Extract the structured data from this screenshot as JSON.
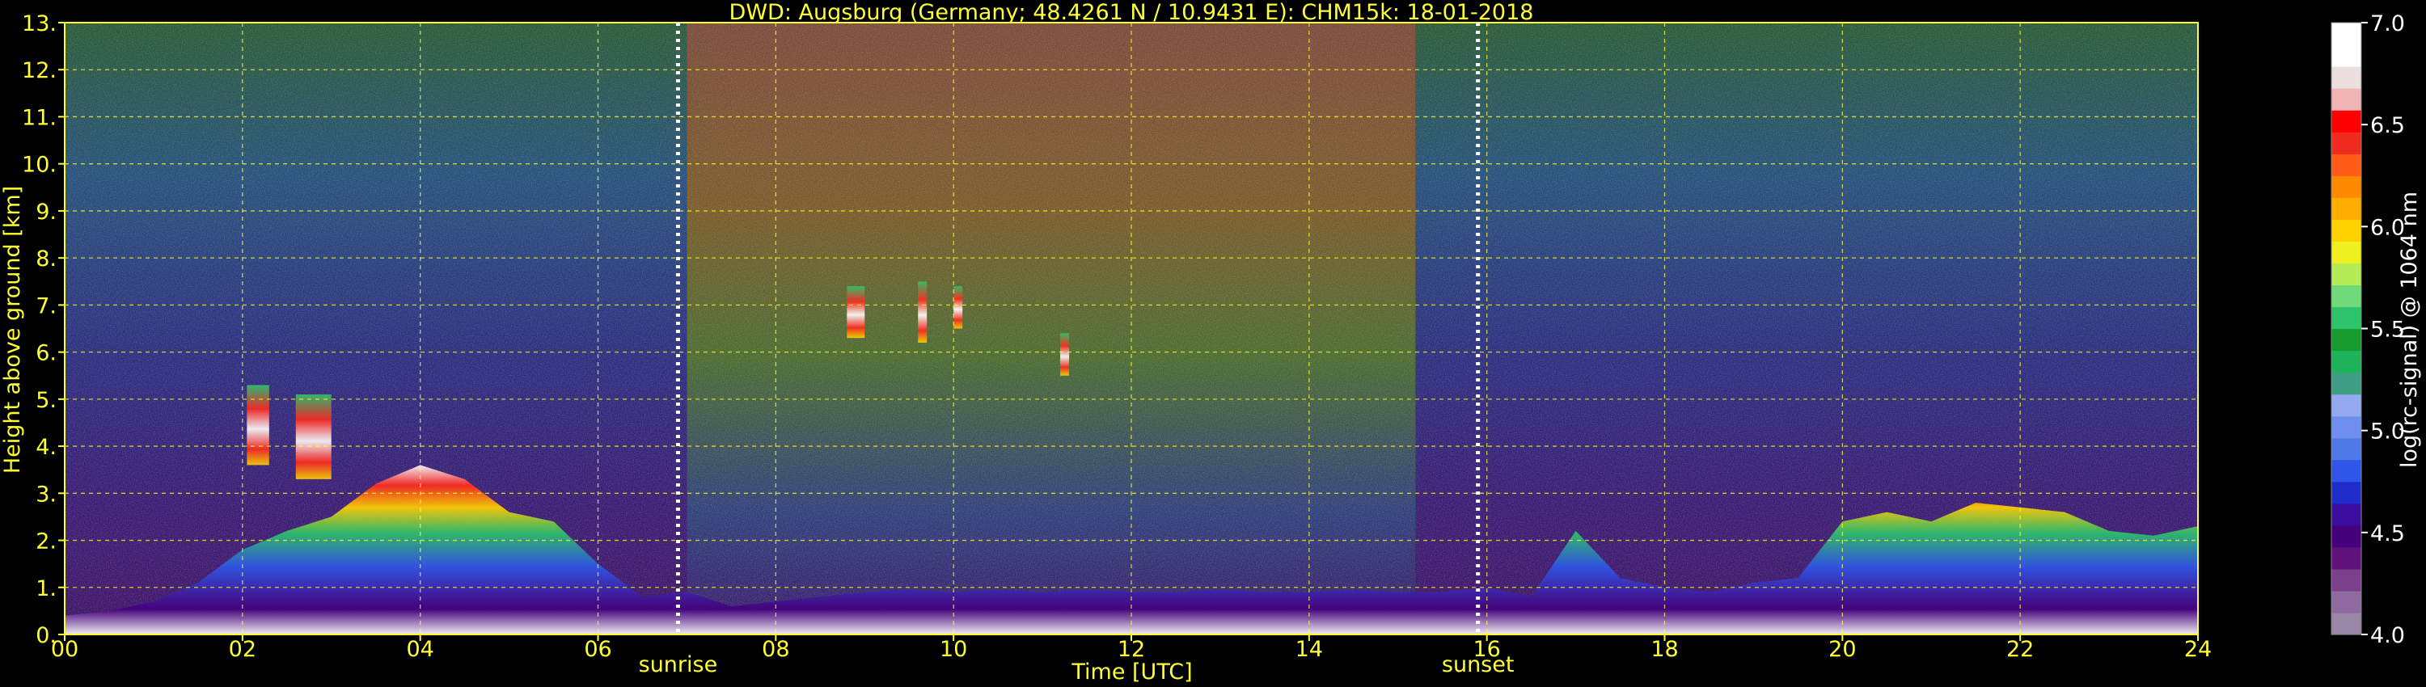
{
  "chart_data": {
    "type": "heatmap",
    "title": "DWD: Augsburg (Germany; 48.4261 N / 10.9431 E):    CHM15k: 18-01-2018",
    "xlabel": "Time [UTC]",
    "ylabel": "Height above ground [km]",
    "xlim": [
      0,
      24
    ],
    "ylim": [
      0,
      13
    ],
    "x_tick_labels": [
      "00",
      "02",
      "04",
      "06",
      "08",
      "10",
      "12",
      "14",
      "16",
      "18",
      "20",
      "22",
      "24"
    ],
    "y_tick_labels": [
      "0.",
      "1.",
      "2.",
      "3.",
      "4.",
      "5.",
      "6.",
      "7.",
      "8.",
      "9.",
      "10.",
      "11.",
      "12.",
      "13."
    ],
    "grid": true,
    "annotations": [
      {
        "label": "sunrise",
        "x": 6.9
      },
      {
        "label": "sunset",
        "x": 15.9
      }
    ],
    "colorbar": {
      "label": "log(rc-signal) @ 1064 nm",
      "range": [
        4.0,
        7.0
      ],
      "tick_labels": [
        "4.0",
        "4.5",
        "5.0",
        "5.5",
        "6.0",
        "6.5",
        "7.0"
      ],
      "colors": [
        "#9a86a6",
        "#8f6aa0",
        "#7c3f8c",
        "#5f127a",
        "#45007c",
        "#3a0d9e",
        "#1f2ccc",
        "#2f56e8",
        "#4f7ae6",
        "#6f8ff0",
        "#93aaf0",
        "#3f9f86",
        "#1fb45c",
        "#179b2d",
        "#2ec46a",
        "#6fda7a",
        "#b4ec57",
        "#f0f020",
        "#ffd200",
        "#ffae00",
        "#ff8a00",
        "#ff5a18",
        "#ef2a1e",
        "#ff0000",
        "#f0b4b4",
        "#eadede",
        "#ffffff",
        "#ffffff"
      ]
    },
    "background_by_hour": [
      {
        "from": 0,
        "to": 7,
        "tone": "night"
      },
      {
        "from": 7,
        "to": 15.2,
        "tone": "day"
      },
      {
        "from": 15.2,
        "to": 24,
        "tone": "night"
      }
    ],
    "layers": [
      {
        "x": [
          0.0,
          0.5,
          1.0,
          1.5,
          2.0,
          2.5,
          3.0,
          3.5,
          4.0,
          4.5,
          5.0,
          5.5,
          6.0,
          6.5,
          7.0,
          7.5,
          8.0,
          8.5,
          9.0,
          9.5,
          10.0,
          10.5,
          11.0,
          11.5,
          12.0,
          12.5,
          13.0,
          13.5,
          14.0,
          14.5,
          15.0,
          15.5,
          16.0,
          16.5,
          17.0,
          17.5,
          18.0,
          18.5,
          19.0,
          19.5,
          20.0,
          20.5,
          21.0,
          21.5,
          22.0,
          22.5,
          23.0,
          23.5,
          24.0
        ],
        "top_km": [
          0.4,
          0.5,
          0.7,
          1.1,
          1.8,
          2.2,
          2.5,
          3.2,
          3.6,
          3.3,
          2.6,
          2.4,
          1.5,
          0.8,
          0.9,
          0.6,
          0.7,
          0.8,
          0.9,
          0.95,
          0.9,
          0.95,
          0.9,
          0.95,
          0.9,
          0.9,
          0.95,
          0.9,
          0.9,
          0.95,
          0.9,
          0.9,
          1.0,
          0.8,
          2.2,
          1.2,
          1.0,
          0.9,
          1.1,
          1.2,
          2.4,
          2.6,
          2.4,
          2.8,
          2.7,
          2.6,
          2.2,
          2.1,
          2.3
        ]
      }
    ],
    "features": [
      {
        "x0": 2.05,
        "x1": 2.3,
        "y0": 3.6,
        "y1": 5.3
      },
      {
        "x0": 2.6,
        "x1": 3.0,
        "y0": 3.3,
        "y1": 5.1
      },
      {
        "x0": 8.8,
        "x1": 9.0,
        "y0": 6.3,
        "y1": 7.4
      },
      {
        "x0": 9.6,
        "x1": 9.7,
        "y0": 6.2,
        "y1": 7.5
      },
      {
        "x0": 10.0,
        "x1": 10.1,
        "y0": 6.5,
        "y1": 7.4
      },
      {
        "x0": 11.2,
        "x1": 11.3,
        "y0": 5.5,
        "y1": 6.4
      }
    ]
  }
}
